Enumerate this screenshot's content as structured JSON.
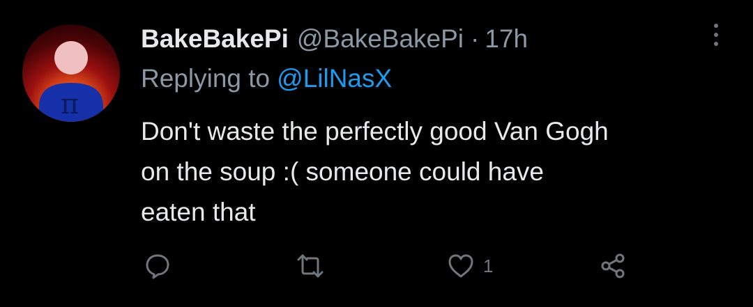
{
  "tweet": {
    "display_name": "BakeBakePi",
    "handle": "@BakeBakePi",
    "separator": "·",
    "time": "17h",
    "replying_label": "Replying to",
    "replying_mention": "@LilNasX",
    "body_lines": [
      "Don't waste the perfectly good Van Gogh",
      "on the soup :( someone could have",
      "eaten that"
    ],
    "avatar_glyph": "π",
    "actions": {
      "reply_icon": "reply-icon",
      "retweet_icon": "retweet-icon",
      "like_icon": "heart-icon",
      "like_count": "1",
      "share_icon": "share-icon"
    }
  },
  "colors": {
    "background": "#000000",
    "primary_text": "#e7e9ea",
    "secondary_text": "#8b98a5",
    "link": "#1d9bf0",
    "icon": "#71767b"
  }
}
